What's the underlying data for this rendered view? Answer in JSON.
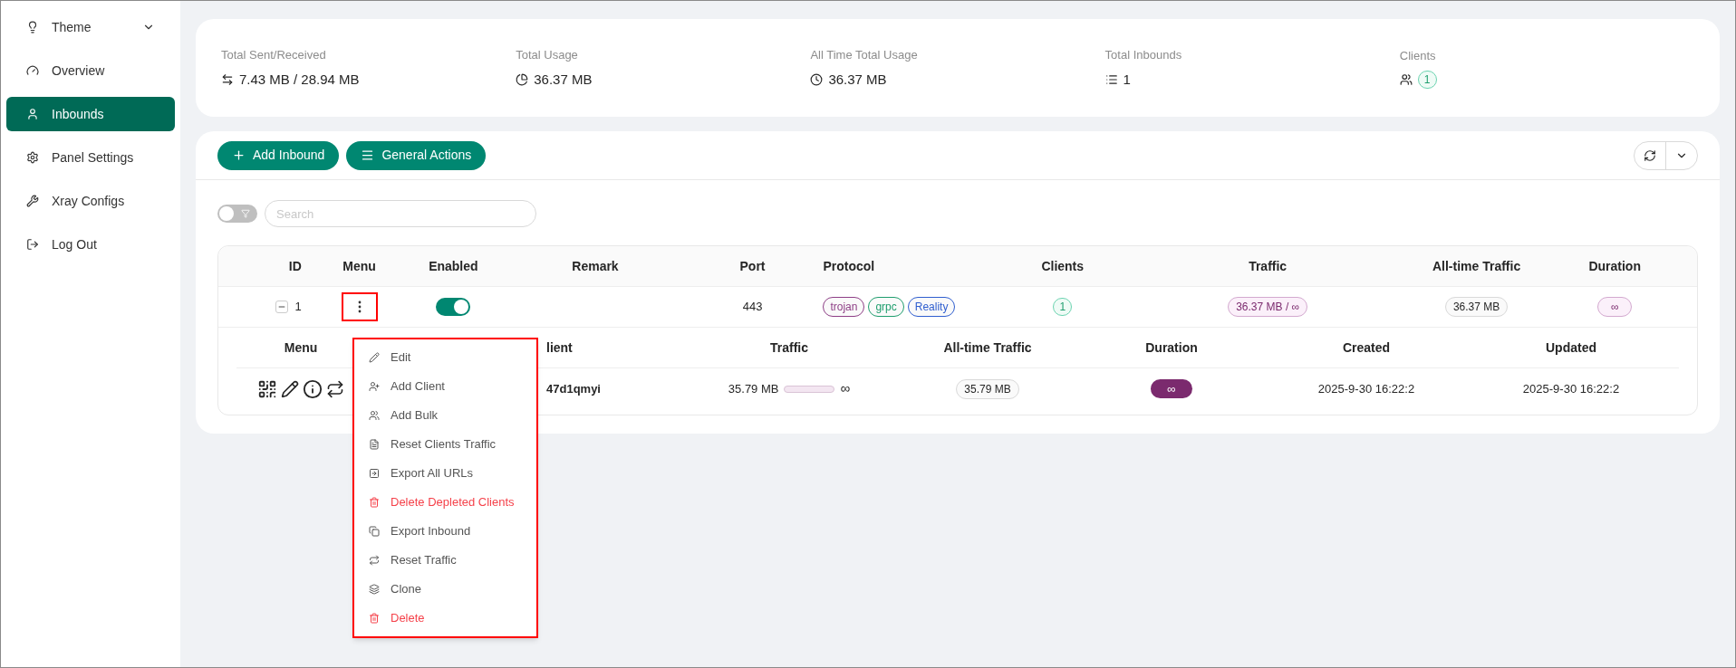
{
  "sidebar": {
    "items": [
      {
        "label": "Theme",
        "kind": "submenu",
        "selected": false
      },
      {
        "label": "Overview",
        "kind": "link",
        "selected": false
      },
      {
        "label": "Inbounds",
        "kind": "link",
        "selected": true
      },
      {
        "label": "Panel Settings",
        "kind": "link",
        "selected": false
      },
      {
        "label": "Xray Configs",
        "kind": "link",
        "selected": false
      },
      {
        "label": "Log Out",
        "kind": "link",
        "selected": false
      }
    ]
  },
  "stats": [
    {
      "label": "Total Sent/Received",
      "value": "7.43 MB / 28.94 MB",
      "kind": "text"
    },
    {
      "label": "Total Usage",
      "value": "36.37 MB",
      "kind": "text"
    },
    {
      "label": "All Time Total Usage",
      "value": "36.37 MB",
      "kind": "text"
    },
    {
      "label": "Total Inbounds",
      "value": "1",
      "kind": "text"
    },
    {
      "label": "Clients",
      "value": "1",
      "kind": "badge"
    }
  ],
  "toolbar": {
    "buttons": [
      "Add Inbound",
      "General Actions"
    ]
  },
  "filter": {
    "on": false,
    "search_placeholder": "Search"
  },
  "table": {
    "columns": [
      "ID",
      "Menu",
      "Enabled",
      "Remark",
      "Port",
      "Protocol",
      "Clients",
      "Traffic",
      "All-time Traffic",
      "Duration"
    ],
    "rows": [
      {
        "id": "1",
        "expanded": true,
        "menu_open": true,
        "enabled": true,
        "remark": "",
        "port": "443",
        "protocols": [
          {
            "label": "trojan",
            "color": "#8e3f86"
          },
          {
            "label": "grpc",
            "color": "#1f9e6e"
          },
          {
            "label": "Reality",
            "color": "#2f5ecf"
          }
        ],
        "clients": "1",
        "traffic": "36.37 MB / ∞",
        "all_time_traffic": "36.37 MB",
        "duration": "∞"
      }
    ]
  },
  "client_table": {
    "columns": [
      "Menu",
      "lient",
      "Traffic",
      "All-time Traffic",
      "Duration",
      "Created",
      "Updated"
    ],
    "rows": [
      {
        "client": "47d1qmyi",
        "traffic": "35.79 MB",
        "level": 0,
        "traffic_limit": "∞",
        "all_time_traffic": "35.79 MB",
        "duration": "∞",
        "created": "2025-9-30 16:22:2",
        "updated": "2025-9-30 16:22:2"
      }
    ]
  },
  "menu": {
    "items": [
      {
        "label": "Edit",
        "kind": "normal"
      },
      {
        "label": "Add Client",
        "kind": "normal"
      },
      {
        "label": "Add Bulk",
        "kind": "normal"
      },
      {
        "label": "Reset Clients Traffic",
        "kind": "normal"
      },
      {
        "label": "Export All URLs",
        "kind": "normal"
      },
      {
        "label": "Delete Depleted Clients",
        "kind": "danger"
      },
      {
        "label": "Export Inbound",
        "kind": "normal"
      },
      {
        "label": "Reset Traffic",
        "kind": "normal"
      },
      {
        "label": "Clone",
        "kind": "normal"
      },
      {
        "label": "Delete",
        "kind": "danger"
      }
    ]
  }
}
